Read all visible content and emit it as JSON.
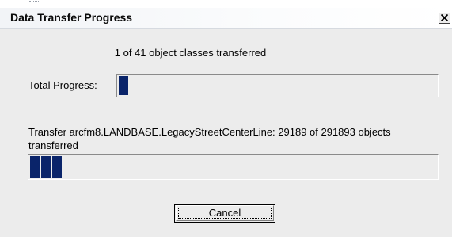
{
  "window": {
    "title": "Data Transfer Progress"
  },
  "status": {
    "overall_text": "1 of 41 object classes transferred",
    "total_label": "Total Progress:",
    "total_progress_fraction": 0.033,
    "transfer_text": "Transfer arcfm8.LANDBASE.LegacyStreetCenterLine: 29189 of 291893 objects transferred",
    "object_progress_fraction": 0.08
  },
  "buttons": {
    "cancel_label": "Cancel"
  },
  "colors": {
    "progress_fill": "#0a246a",
    "dialog_bg": "#ececec"
  },
  "icons": {
    "close": "close-icon"
  }
}
